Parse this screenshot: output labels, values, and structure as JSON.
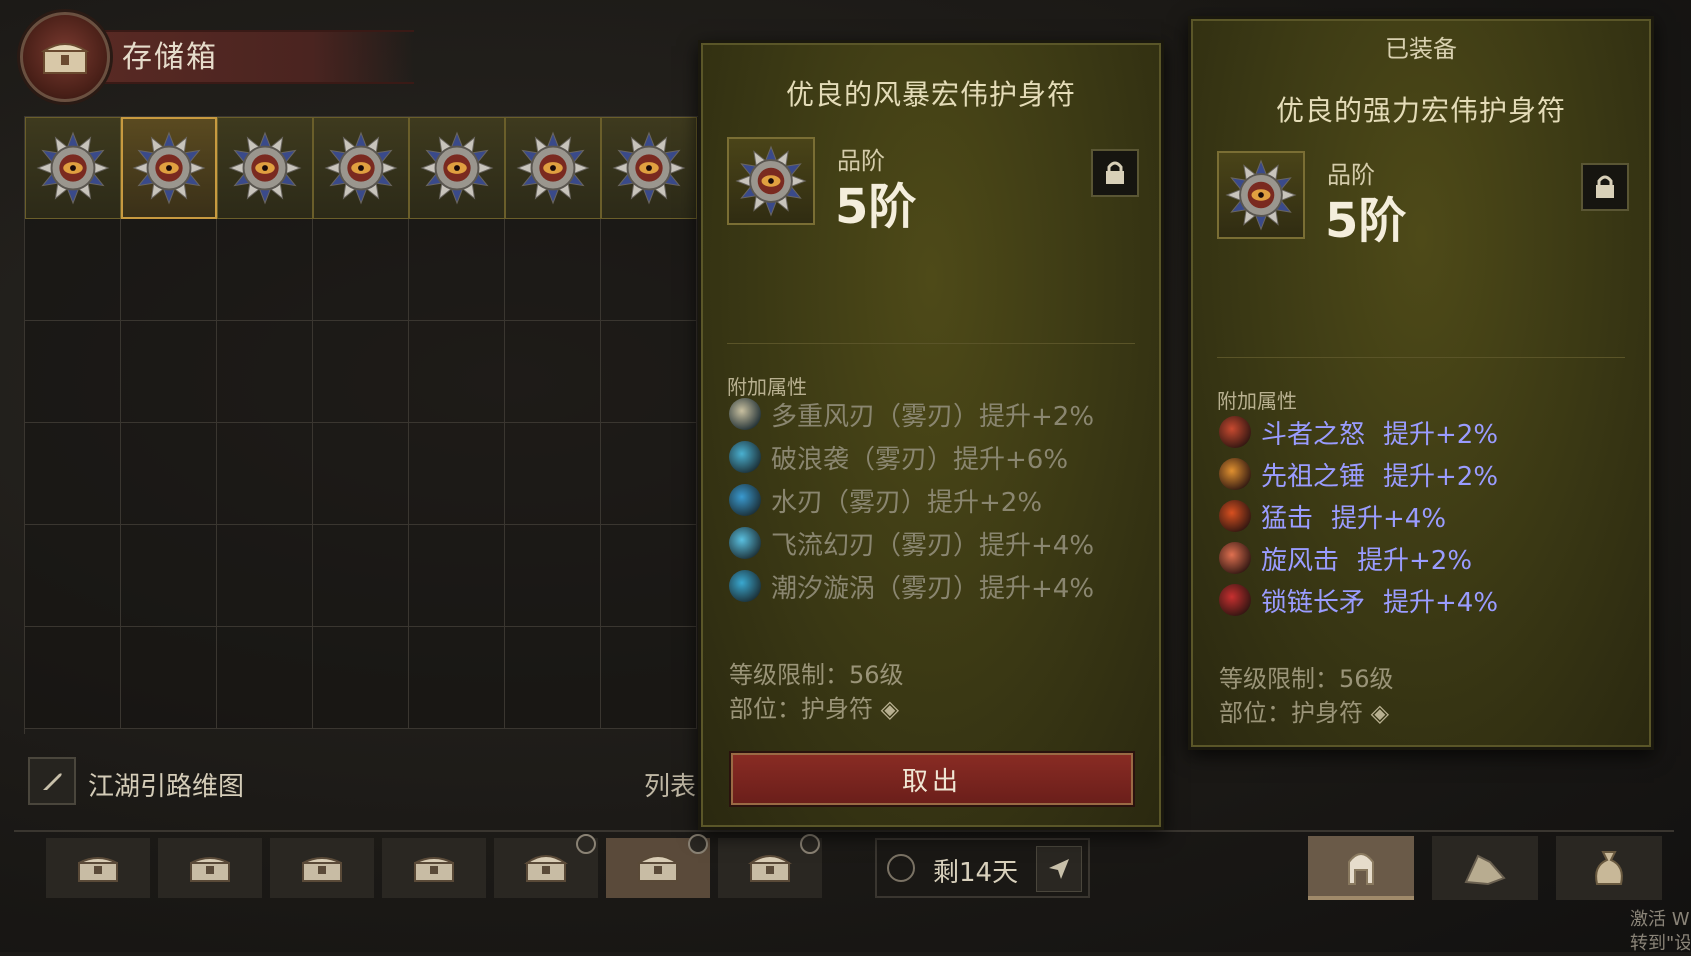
{
  "header": {
    "title": "存储箱"
  },
  "grid": {
    "columns": 7,
    "rows": 6,
    "filled": 7,
    "selected_index": 1
  },
  "guide": {
    "label": "江湖引路维图",
    "list_label": "列表"
  },
  "timer": {
    "text": "剩14天"
  },
  "tooltip_storage": {
    "title": "优良的风暴宏伟护身符",
    "rank_label": "品阶",
    "rank_value": "5阶",
    "attr_title": "附加属性",
    "attributes": [
      {
        "text": "多重风刃（雾刃）提升+2%"
      },
      {
        "text": "破浪袭（雾刃）提升+6%"
      },
      {
        "text": "水刃（雾刃）提升+2%"
      },
      {
        "text": "飞流幻刃（雾刃）提升+4%"
      },
      {
        "text": "潮汐漩涡（雾刃）提升+4%"
      }
    ],
    "level_req": "等级限制：56级",
    "slot": "部位：护身符",
    "take_button": "取出"
  },
  "tooltip_equipped": {
    "equipped_label": "已装备",
    "title": "优良的强力宏伟护身符",
    "rank_label": "品阶",
    "rank_value": "5阶",
    "attr_title": "附加属性",
    "attributes": [
      {
        "name": "斗者之怒",
        "bonus": "提升+2%"
      },
      {
        "name": "先祖之锤",
        "bonus": "提升+2%"
      },
      {
        "name": "猛击",
        "bonus": "提升+4%"
      },
      {
        "name": "旋风击",
        "bonus": "提升+2%"
      },
      {
        "name": "锁链长矛",
        "bonus": "提升+4%"
      }
    ],
    "level_req": "等级限制：56级",
    "slot": "部位：护身符"
  },
  "watermark": {
    "line1": "激活 W",
    "line2": "转到\"设置"
  },
  "colors": {
    "accent_gold": "#c89a40",
    "attr_blue": "#9a9cff",
    "take_red": "#8a2c24"
  },
  "icons": [
    "chest-icon",
    "amulet-icon",
    "lock-icon",
    "quill-icon",
    "clock-icon",
    "send-icon",
    "helmet-icon",
    "ore-icon",
    "pouch-icon"
  ]
}
